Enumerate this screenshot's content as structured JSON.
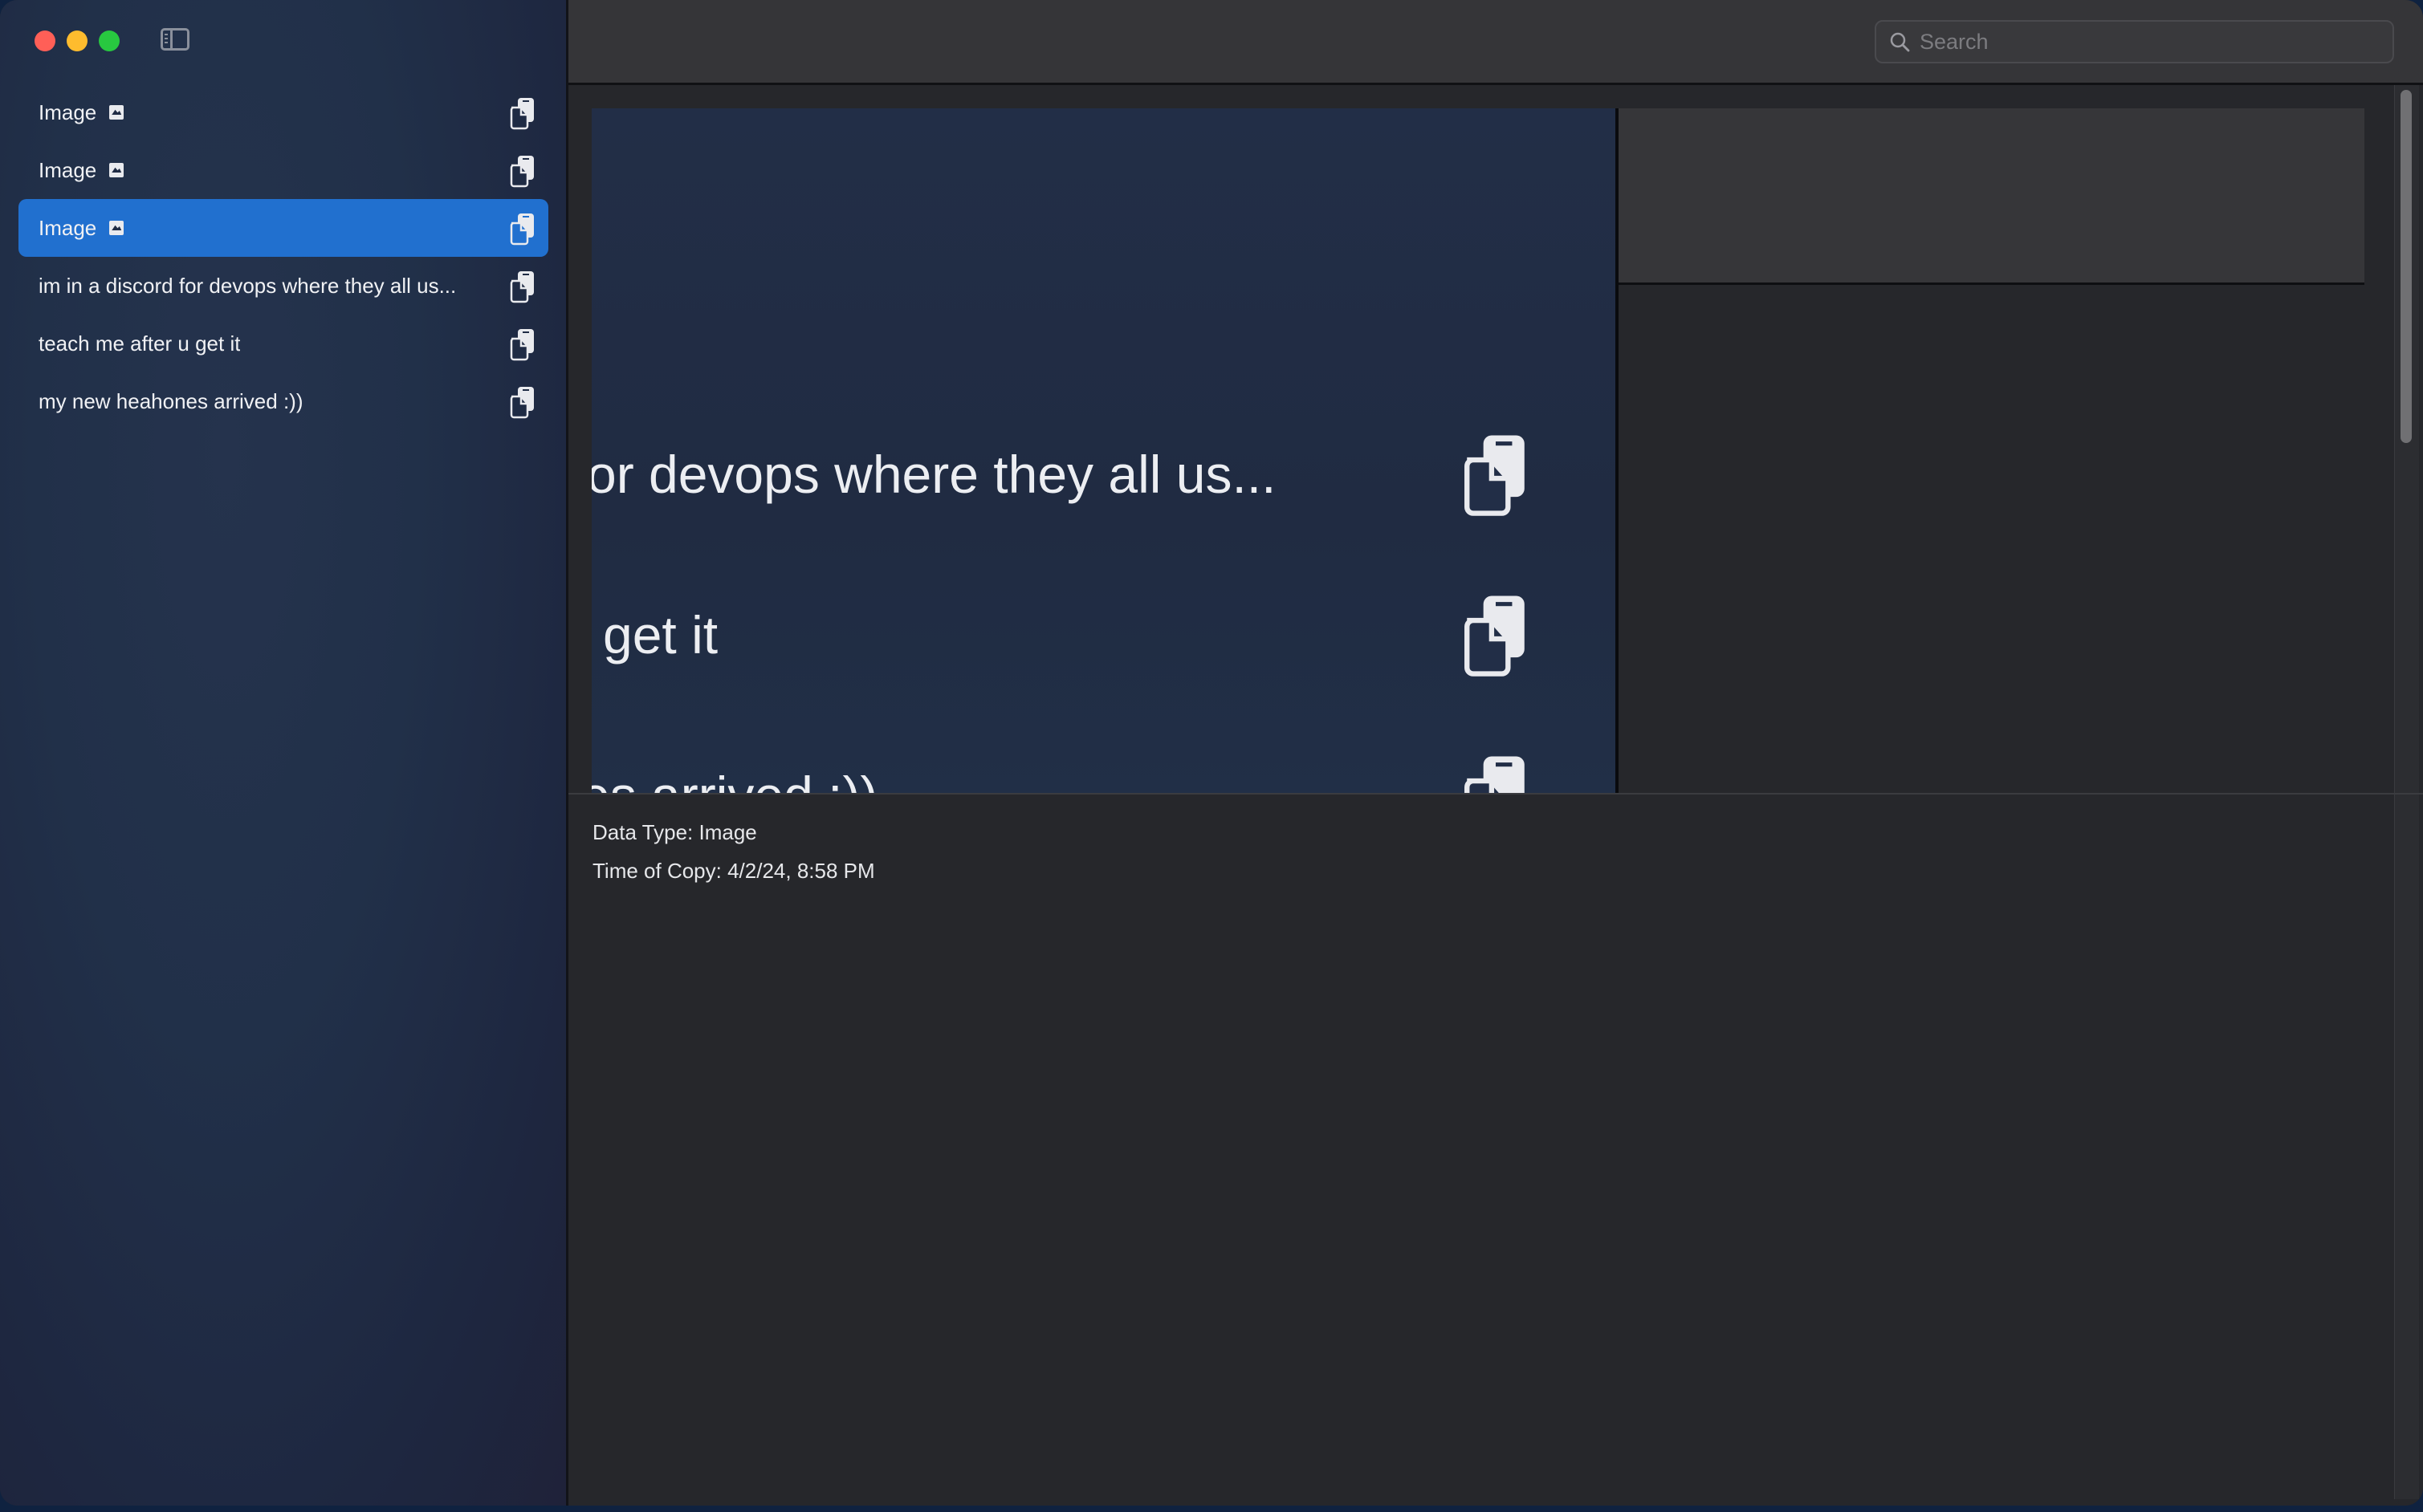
{
  "window": {
    "controls": [
      "close",
      "minimize",
      "maximize"
    ]
  },
  "sidebar": {
    "toggle_icon": "sidebar-left-icon",
    "items": [
      {
        "label": "Image",
        "type_icon": "photo-icon",
        "selected": false,
        "action_icon": "copy-icon"
      },
      {
        "label": "Image",
        "type_icon": "photo-icon",
        "selected": false,
        "action_icon": "copy-icon"
      },
      {
        "label": "Image",
        "type_icon": "photo-icon",
        "selected": true,
        "action_icon": "copy-icon"
      },
      {
        "label": "im in a discord for devops where they all us...",
        "selected": false,
        "action_icon": "copy-icon"
      },
      {
        "label": "teach me after u get it",
        "selected": false,
        "action_icon": "copy-icon"
      },
      {
        "label": "my new heahones arrived :))",
        "selected": false,
        "action_icon": "copy-icon"
      }
    ]
  },
  "toolbar": {
    "search": {
      "placeholder": "Search",
      "value": "",
      "icon": "magnifier-icon"
    }
  },
  "preview": {
    "rows": [
      {
        "text": "or devops where they all us..."
      },
      {
        "text": "get it"
      },
      {
        "text": "es arrived :))"
      }
    ]
  },
  "details": {
    "data_type": "Data Type: Image",
    "time_of_copy": "Time of Copy: 4/2/24, 8:58 PM"
  },
  "colors": {
    "selection": "#2170cf",
    "close": "#ff5f57",
    "minimize": "#febc2e",
    "maximize": "#28c840"
  }
}
